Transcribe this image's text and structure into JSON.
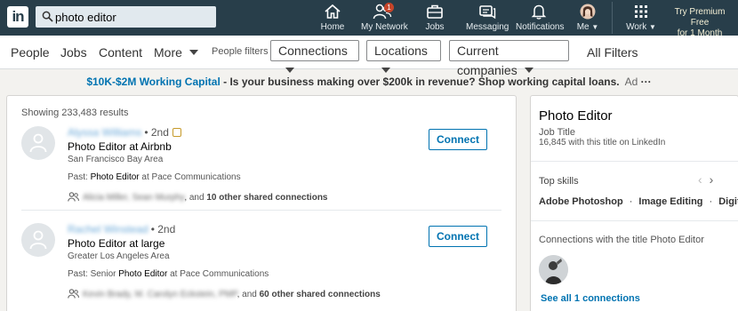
{
  "nav": {
    "logo": "in",
    "search_value": "photo editor",
    "items": [
      {
        "label": "Home",
        "icon": "home-icon"
      },
      {
        "label": "My Network",
        "icon": "network-icon",
        "badge": "1"
      },
      {
        "label": "Jobs",
        "icon": "briefcase-icon"
      },
      {
        "label": "Messaging",
        "icon": "messaging-icon"
      },
      {
        "label": "Notifications",
        "icon": "bell-icon"
      },
      {
        "label": "Me",
        "icon": "avatar"
      },
      {
        "label": "Work",
        "icon": "grid-icon"
      }
    ],
    "premium_line1": "Try Premium Free",
    "premium_line2": "for 1 Month"
  },
  "filters": {
    "tabs": [
      "People",
      "Jobs",
      "Content",
      "More"
    ],
    "people_filters_label": "People filters",
    "dropdowns": [
      "Connections",
      "Locations",
      "Current companies"
    ],
    "all_filters": "All Filters"
  },
  "ad": {
    "link": "$10K-$2M Working Capital",
    "text": " - Is your business making over $200k in revenue? Shop working capital loans.",
    "tag": "Ad",
    "more": "···"
  },
  "results": {
    "count_text": "Showing 233,483 results",
    "connect_label": "Connect",
    "people": [
      {
        "name": "Alyssa Williams",
        "degree": "• 2nd",
        "headline": "Photo Editor at Airbnb",
        "location": "San Francisco Bay Area",
        "past_prefix": "Past: ",
        "past_match": "Photo Editor",
        "past_suffix": " at Pace Communications",
        "shared_names": "Alicia Miller, Sean Murphy",
        "shared_tail": ", and ",
        "shared_count": "10 other shared connections"
      },
      {
        "name": "Rachel Winstead",
        "degree": "• 2nd",
        "headline": "Photo Editor at large",
        "location": "Greater Los Angeles Area",
        "past_prefix": "Past: Senior ",
        "past_match": "Photo Editor",
        "past_suffix": " at Pace Communications",
        "shared_names": "Kevin Brady, M. Carolyn Eckstein, PMP",
        "shared_tail": ", and ",
        "shared_count": "60 other shared connections"
      }
    ]
  },
  "panel": {
    "title": "Photo Editor",
    "subtitle": "Job Title",
    "count_text": "16,845 with this title on LinkedIn",
    "top_skills_label": "Top skills",
    "skills": [
      "Adobe Photoshop",
      "Image Editing",
      "Digital"
    ],
    "connections_label": "Connections with the title Photo Editor",
    "see_all": "See all 1 connections"
  },
  "colors": {
    "nav_bg": "#283e4a",
    "link_blue": "#0073b1",
    "page_bg": "#f3f2ef"
  }
}
